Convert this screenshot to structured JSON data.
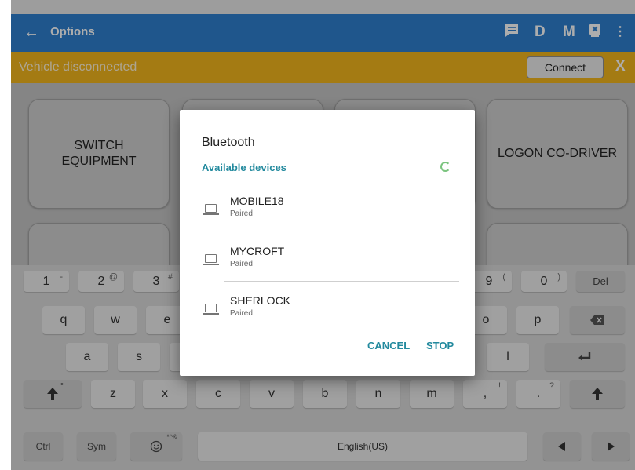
{
  "appbar": {
    "back_icon": "back-arrow-icon",
    "title": "Options",
    "icons": {
      "message": "message-icon",
      "d_label": "D",
      "m_label": "M",
      "device": "device-icon",
      "menu": "more-vert-icon"
    },
    "color": "#2f7fcf"
  },
  "connection_bar": {
    "message": "Vehicle disconnected",
    "connect_label": "Connect",
    "close_label": "X",
    "color": "#f2b51d"
  },
  "tiles": {
    "switch_equipment": "SWITCH EQUIPMENT",
    "logon_codriver": "LOGON CO-DRIVER"
  },
  "dialog": {
    "title": "Bluetooth",
    "subtitle": "Available devices",
    "devices": [
      {
        "name": "MOBILE18",
        "status": "Paired"
      },
      {
        "name": "MYCROFT",
        "status": "Paired"
      },
      {
        "name": "SHERLOCK",
        "status": "Paired"
      }
    ],
    "cancel_label": "CANCEL",
    "stop_label": "STOP",
    "accent": "#238a9e"
  },
  "keyboard": {
    "row1": [
      {
        "label": "1",
        "sup": "-"
      },
      {
        "label": "2",
        "sup": "@"
      },
      {
        "label": "3",
        "sup": "#"
      },
      {
        "label": "9",
        "sup": "("
      },
      {
        "label": "0",
        "sup": ")"
      },
      {
        "label": "Del",
        "sup": ""
      }
    ],
    "row2": [
      "q",
      "w",
      "e",
      "o",
      "p"
    ],
    "row3": [
      "a",
      "s",
      "l"
    ],
    "row4": [
      {
        "label": "z",
        "sup": ""
      },
      {
        "label": "x",
        "sup": ""
      },
      {
        "label": "c",
        "sup": ""
      },
      {
        "label": "v",
        "sup": ""
      },
      {
        "label": "b",
        "sup": ""
      },
      {
        "label": "n",
        "sup": ""
      },
      {
        "label": "m",
        "sup": ""
      },
      {
        "label": ",",
        "sup": "!"
      },
      {
        "label": ".",
        "sup": "?"
      }
    ],
    "row5": {
      "ctrl": "Ctrl",
      "sym": "Sym",
      "emoji_sup": "*^&",
      "space": "English(US)"
    },
    "icons": {
      "backspace": "backspace-icon",
      "enter": "enter-icon",
      "shift": "shift-icon",
      "emoji": "emoji-icon",
      "left": "arrow-left-icon",
      "right": "arrow-right-icon"
    }
  }
}
